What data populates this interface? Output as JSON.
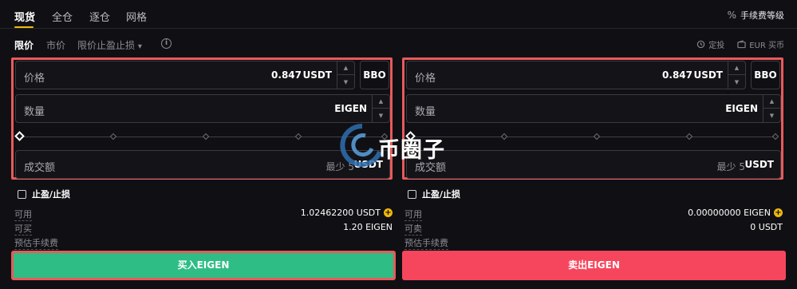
{
  "tabs": [
    "现货",
    "全仓",
    "逐仓",
    "网格"
  ],
  "fee_level": {
    "icon": "percent-icon",
    "label": "手续费等级"
  },
  "order_types": {
    "limit": "限价",
    "market": "市价",
    "tpsl": "限价止盈止损",
    "tpsl_arrow": "▾"
  },
  "tools": {
    "auto_invest": "定投",
    "buy_fiat": "EUR 买币"
  },
  "buy_form": {
    "price_label": "价格",
    "price_value": "0.847",
    "price_unit": "USDT",
    "bbo": "BBO",
    "qty_label": "数量",
    "qty_unit": "EIGEN",
    "amount_label": "成交额",
    "amount_min": "最少 5",
    "amount_unit": "USDT",
    "tpsl_label": "止盈/止损",
    "avail_label": "可用",
    "avail_value": "1.02462200 USDT",
    "can_buy_label": "可买",
    "can_buy_value": "1.20 EIGEN",
    "fee_label": "预估手续费",
    "submit": "买入EIGEN"
  },
  "sell_form": {
    "price_label": "价格",
    "price_value": "0.847",
    "price_unit": "USDT",
    "bbo": "BBO",
    "qty_label": "数量",
    "qty_unit": "EIGEN",
    "amount_label": "成交额",
    "amount_min": "最少 5",
    "amount_unit": "USDT",
    "tpsl_label": "止盈/止损",
    "avail_label": "可用",
    "avail_value": "0.00000000 EIGEN",
    "can_sell_label": "可卖",
    "can_sell_value": "0 USDT",
    "fee_label": "预估手续费",
    "submit": "卖出EIGEN"
  },
  "watermark": "币圈子",
  "colors": {
    "accent": "#f0b90b",
    "buy": "#2ebd85",
    "sell": "#f6465d",
    "highlight": "#e85a5a"
  }
}
